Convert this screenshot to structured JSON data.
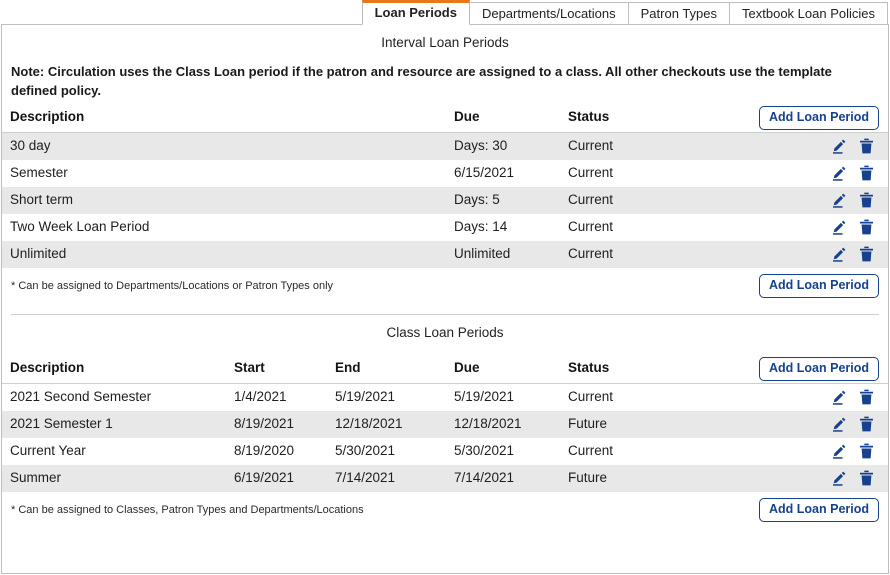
{
  "tabs": [
    {
      "label": "Loan Periods",
      "active": true
    },
    {
      "label": "Departments/Locations",
      "active": false
    },
    {
      "label": "Patron Types",
      "active": false
    },
    {
      "label": "Textbook Loan Policies",
      "active": false
    }
  ],
  "accent_color": "#e8761a",
  "link_color": "#16418c",
  "row_alt_color": "#e8e8e8",
  "interval_section": {
    "title": "Interval Loan Periods",
    "note_label": "Note:",
    "note_text": "Note: Circulation uses the Class Loan period if the patron and resource are assigned to a class. All other checkouts use the template defined policy.",
    "add_button_label": "Add Loan Period",
    "columns": {
      "description": "Description",
      "due": "Due",
      "status": "Status"
    },
    "rows": [
      {
        "description": "30 day",
        "due": "Days: 30",
        "status": "Current"
      },
      {
        "description": "Semester",
        "due": "6/15/2021",
        "status": "Current"
      },
      {
        "description": "Short term",
        "due": "Days: 5",
        "status": "Current"
      },
      {
        "description": "Two Week Loan Period",
        "due": "Days: 14",
        "status": "Current"
      },
      {
        "description": "Unlimited",
        "due": "Unlimited",
        "status": "Current"
      }
    ],
    "footnote": "* Can be assigned to Departments/Locations or Patron Types only",
    "footer_add_button_label": "Add Loan Period"
  },
  "class_section": {
    "title": "Class Loan Periods",
    "add_button_label": "Add Loan Period",
    "columns": {
      "description": "Description",
      "start": "Start",
      "end": "End",
      "due": "Due",
      "status": "Status"
    },
    "rows": [
      {
        "description": "2021 Second Semester",
        "start": "1/4/2021",
        "end": "5/19/2021",
        "due": "5/19/2021",
        "status": "Current"
      },
      {
        "description": "2021 Semester 1",
        "start": "8/19/2021",
        "end": "12/18/2021",
        "due": "12/18/2021",
        "status": "Future"
      },
      {
        "description": "Current Year",
        "start": "8/19/2020",
        "end": "5/30/2021",
        "due": "5/30/2021",
        "status": "Current"
      },
      {
        "description": "Summer",
        "start": "6/19/2021",
        "end": "7/14/2021",
        "due": "7/14/2021",
        "status": "Future"
      }
    ],
    "footnote": "* Can be assigned to Classes, Patron Types and Departments/Locations",
    "footer_add_button_label": "Add Loan Period"
  },
  "icons": {
    "edit": "pencil-icon",
    "delete": "trash-icon"
  }
}
